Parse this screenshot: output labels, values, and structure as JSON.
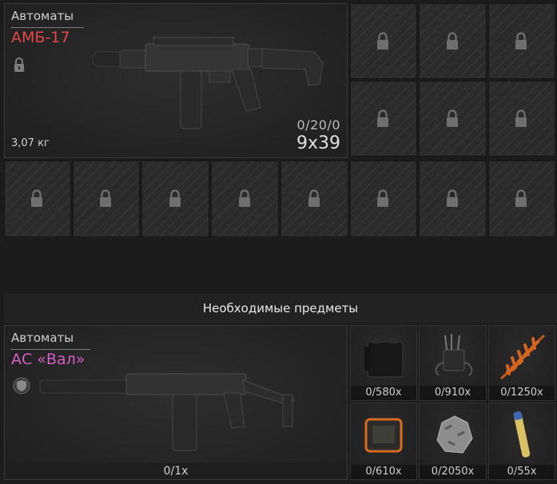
{
  "slot_weapon": {
    "category": "Автоматы",
    "name": "АМБ-17",
    "name_color": "#e2474a",
    "weight": "3,07 кг",
    "ammo_count": "0/20/0",
    "caliber": "9x39",
    "lock_icon": "padlock-icon"
  },
  "locked_cells_icon": "padlock-icon",
  "required_section": {
    "title": "Необходимые предметы"
  },
  "required_weapon": {
    "category": "Автоматы",
    "name": "АС «Вал»",
    "name_color": "#d65ec9",
    "shield_icon": "shield-icon",
    "quantity": "0/1x"
  },
  "required_items": [
    {
      "icon": "battery-box-icon",
      "count": "0/580x"
    },
    {
      "icon": "wired-device-icon",
      "count": "0/910x"
    },
    {
      "icon": "fern-leaf-icon",
      "count": "0/1250x"
    },
    {
      "icon": "orange-gadget-icon",
      "count": "0/610x"
    },
    {
      "icon": "rock-ore-icon",
      "count": "0/2050x"
    },
    {
      "icon": "vial-tube-icon",
      "count": "0/55x"
    }
  ]
}
